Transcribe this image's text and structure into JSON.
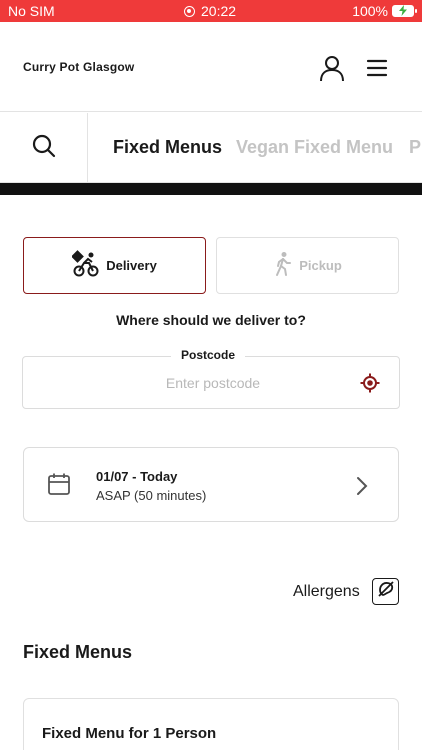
{
  "status_bar": {
    "carrier": "No SIM",
    "time": "20:22",
    "battery": "100%"
  },
  "header": {
    "store_name": "Curry Pot Glasgow"
  },
  "tabs": [
    {
      "label": "Fixed Menus",
      "active": true
    },
    {
      "label": "Vegan Fixed Menu",
      "active": false
    },
    {
      "label": "P",
      "active": false
    }
  ],
  "order_mode": {
    "delivery_label": "Delivery",
    "pickup_label": "Pickup",
    "selected": "delivery"
  },
  "delivery_question": "Where should we deliver to?",
  "postcode": {
    "label": "Postcode",
    "placeholder": "Enter postcode",
    "value": ""
  },
  "schedule": {
    "date": "01/07 - Today",
    "time": "ASAP (50 minutes)"
  },
  "allergens_label": "Allergens",
  "section_title": "Fixed Menus",
  "menu_card": {
    "title": "Fixed Menu for 1 Person"
  },
  "colors": {
    "status_bar": "#ef3a3a",
    "accent": "#8a1b1b",
    "band": "#111111"
  }
}
